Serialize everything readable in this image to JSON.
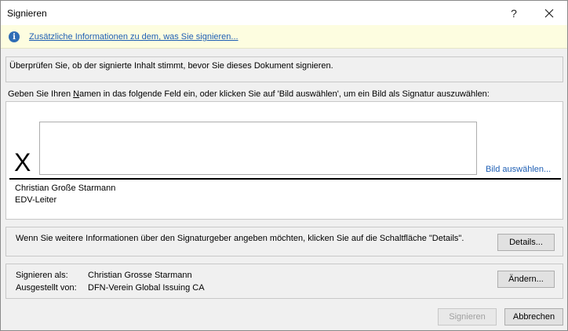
{
  "window": {
    "title": "Signieren",
    "help_glyph": "?",
    "close_glyph": "✕"
  },
  "infobar": {
    "icon": "info-icon",
    "link_text": "Zusätzliche Informationen zu dem, was Sie signieren..."
  },
  "verify_text": "Überprüfen Sie, ob der signierte Inhalt stimmt, bevor Sie dieses Dokument signieren.",
  "prompt": {
    "before": "Geben Sie Ihren ",
    "underlined": "N",
    "after": "amen in das folgende Feld ein, oder klicken Sie auf 'Bild auswählen', um ein Bild als Signatur auszuwählen:"
  },
  "signature": {
    "x_mark": "X",
    "input_value": "",
    "pick_image_label": "Bild auswählen...",
    "signer_name": "Christian Große Starmann",
    "signer_title": "EDV-Leiter"
  },
  "details": {
    "text": "Wenn Sie weitere Informationen über den Signaturgeber angeben möchten, klicken Sie auf die Schaltfläche \"Details\".",
    "button_label": "Details..."
  },
  "sign_as": {
    "label_sign_as": "Signieren als:",
    "value_sign_as": "Christian Grosse Starmann",
    "label_issued_by": "Ausgestellt von:",
    "value_issued_by": "DFN-Verein Global Issuing CA",
    "change_button_label": "Ändern..."
  },
  "footer": {
    "sign_button_label": "Signieren",
    "cancel_button_label": "Abbrechen"
  },
  "colors": {
    "link": "#1f5fb4",
    "infobar_bg": "#fdfde0",
    "info_icon": "#2f6db5"
  }
}
